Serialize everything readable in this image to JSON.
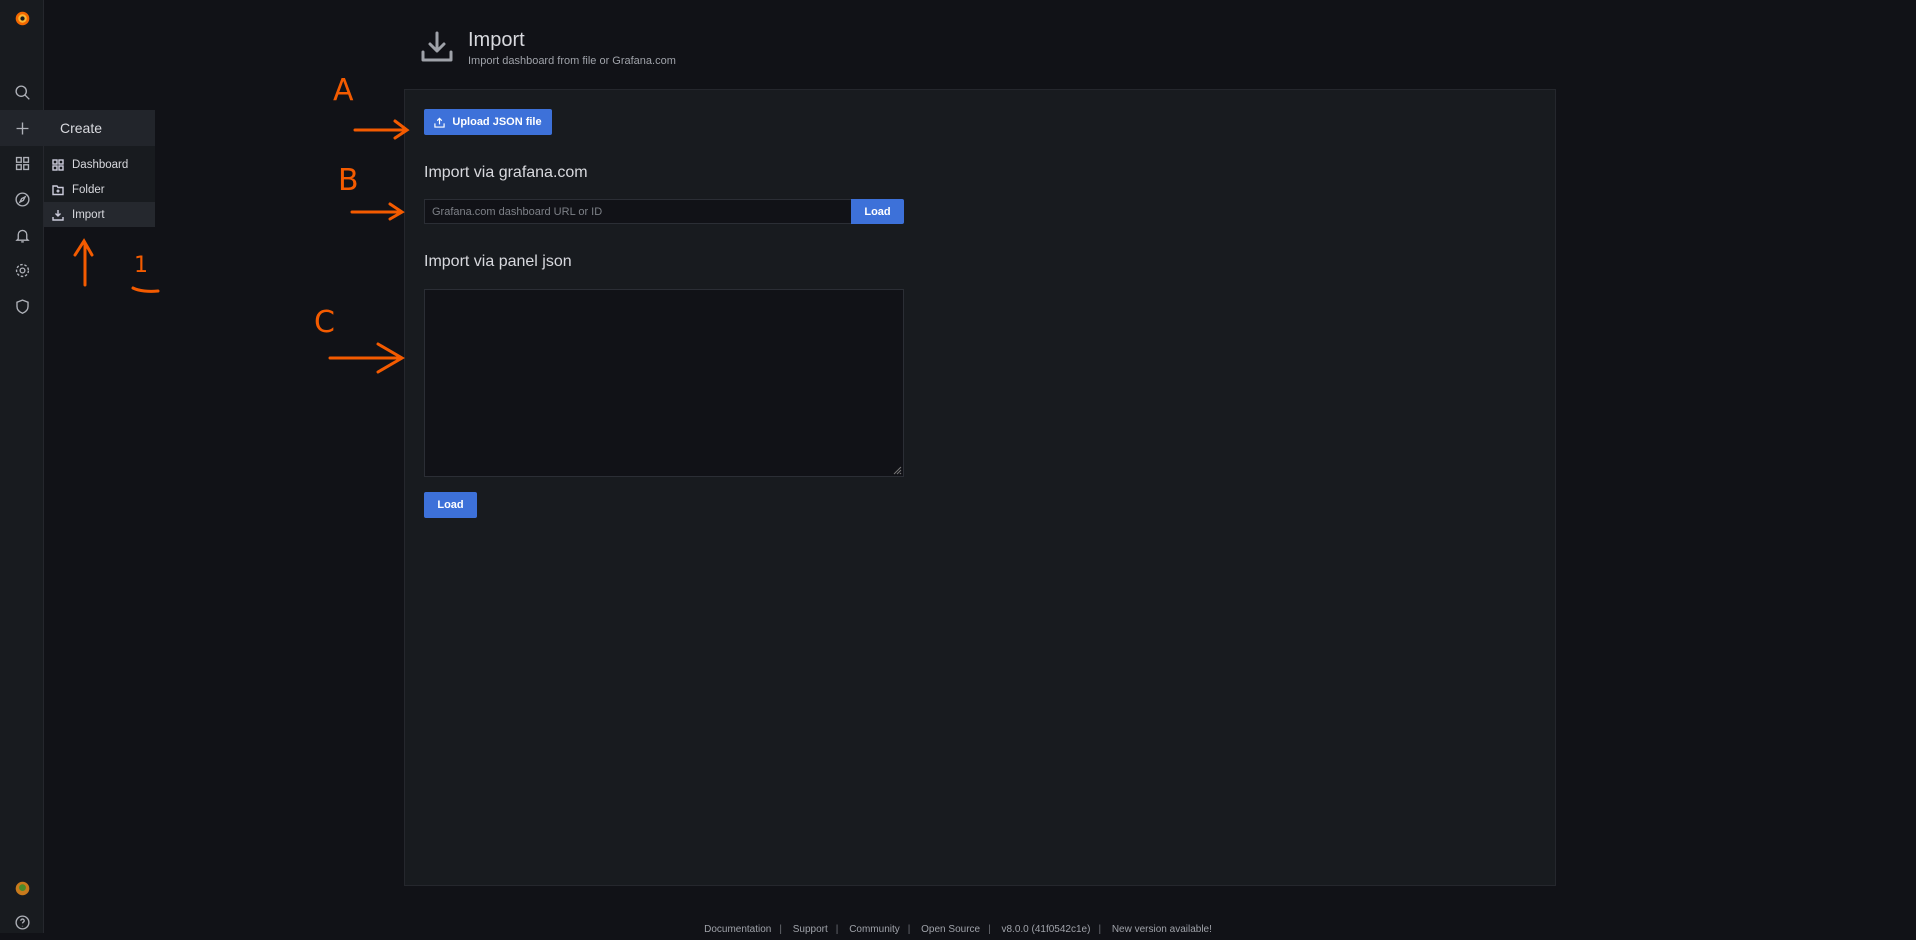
{
  "sidebar": {
    "items": [
      "grafana-logo",
      "search",
      "create",
      "dashboards",
      "explore",
      "alerting",
      "configuration",
      "server-admin"
    ],
    "bottom": [
      "profile-avatar",
      "help"
    ]
  },
  "flyout": {
    "title": "Create",
    "items": [
      {
        "label": "Dashboard",
        "icon": "apps-icon"
      },
      {
        "label": "Folder",
        "icon": "folder-plus-icon"
      },
      {
        "label": "Import",
        "icon": "import-icon",
        "active": true
      }
    ]
  },
  "header": {
    "title": "Import",
    "subtitle": "Import dashboard from file or Grafana.com"
  },
  "main": {
    "upload_label": "Upload JSON file",
    "grafana_heading": "Import via grafana.com",
    "grafana_placeholder": "Grafana.com dashboard URL or ID",
    "grafana_load": "Load",
    "panel_heading": "Import via panel json",
    "panel_load": "Load"
  },
  "footer": {
    "items": [
      "Documentation",
      "Support",
      "Community",
      "Open Source",
      "v8.0.0 (41f0542c1e)",
      "New version available!"
    ]
  },
  "annotations": {
    "labels": [
      "A",
      "B",
      "C",
      "1"
    ],
    "color": "#f45b00"
  },
  "colors": {
    "primary": "#3d71d9",
    "background": "#111217",
    "panel": "#181b1f"
  }
}
